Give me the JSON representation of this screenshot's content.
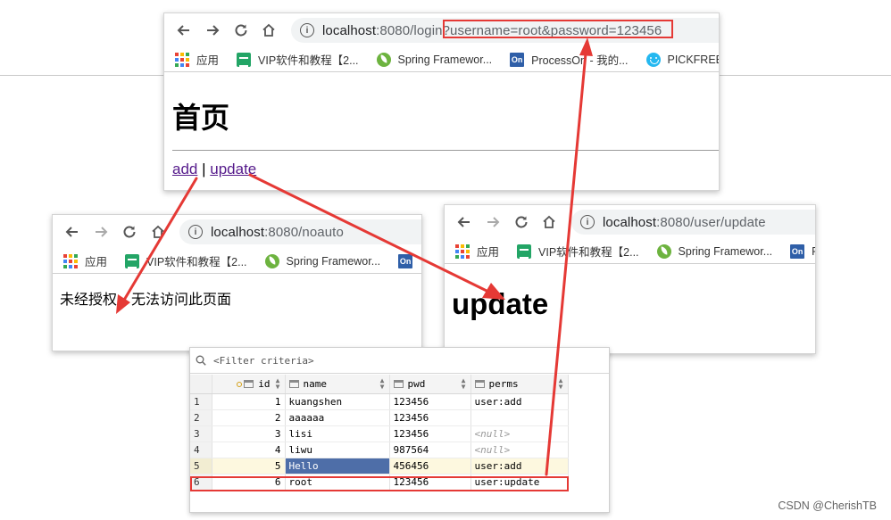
{
  "colors": {
    "red_annotation": "#e53935",
    "link_visited": "#551a8b",
    "selection": "#4e6ea8",
    "row_highlight": "#fdf8df"
  },
  "icons": [
    "back-arrow-icon",
    "forward-arrow-icon",
    "reload-icon",
    "home-icon",
    "info-icon",
    "apps-grid-icon",
    "spreadsheet-icon",
    "spring-leaf-icon",
    "on-logo-icon",
    "smiley-icon",
    "search-icon",
    "key-icon",
    "column-icon",
    "sort-icon"
  ],
  "win1": {
    "url_host": "localhost",
    "url_rest": ":8080/login?username=root&password=123456",
    "bookmarks": [
      "应用",
      "VIP软件和教程【2...",
      "Spring Framewor...",
      "ProcessOn - 我的...",
      "PICKFREE"
    ],
    "heading": "首页",
    "link_add": "add",
    "separator": "|",
    "link_update": "update"
  },
  "win2": {
    "url_host": "localhost",
    "url_rest": ":8080/noauto",
    "bookmarks": [
      "应用",
      "VIP软件和教程【2...",
      "Spring Framewor..."
    ],
    "message": "未经授权，无法访问此页面"
  },
  "win3": {
    "url_host": "localhost",
    "url_rest": ":8080/user/update",
    "bookmarks": [
      "应用",
      "VIP软件和教程【2...",
      "Spring Framewor...",
      "P"
    ],
    "heading": "update"
  },
  "grid": {
    "filter_placeholder": "<Filter criteria>",
    "columns": [
      "id",
      "name",
      "pwd",
      "perms"
    ],
    "rows": [
      {
        "n": "1",
        "id": "1",
        "name": "kuangshen",
        "pwd": "123456",
        "perms": "user:add"
      },
      {
        "n": "2",
        "id": "2",
        "name": "aaaaaa",
        "pwd": "123456",
        "perms": ""
      },
      {
        "n": "3",
        "id": "3",
        "name": "lisi",
        "pwd": "123456",
        "perms": "<null>"
      },
      {
        "n": "4",
        "id": "4",
        "name": "liwu",
        "pwd": "987564",
        "perms": "<null>"
      },
      {
        "n": "5",
        "id": "5",
        "name": "Hello",
        "pwd": "456456",
        "perms": "user:add"
      },
      {
        "n": "6",
        "id": "6",
        "name": "root",
        "pwd": "123456",
        "perms": "user:update"
      }
    ]
  },
  "watermark": "CSDN @CherishTB"
}
